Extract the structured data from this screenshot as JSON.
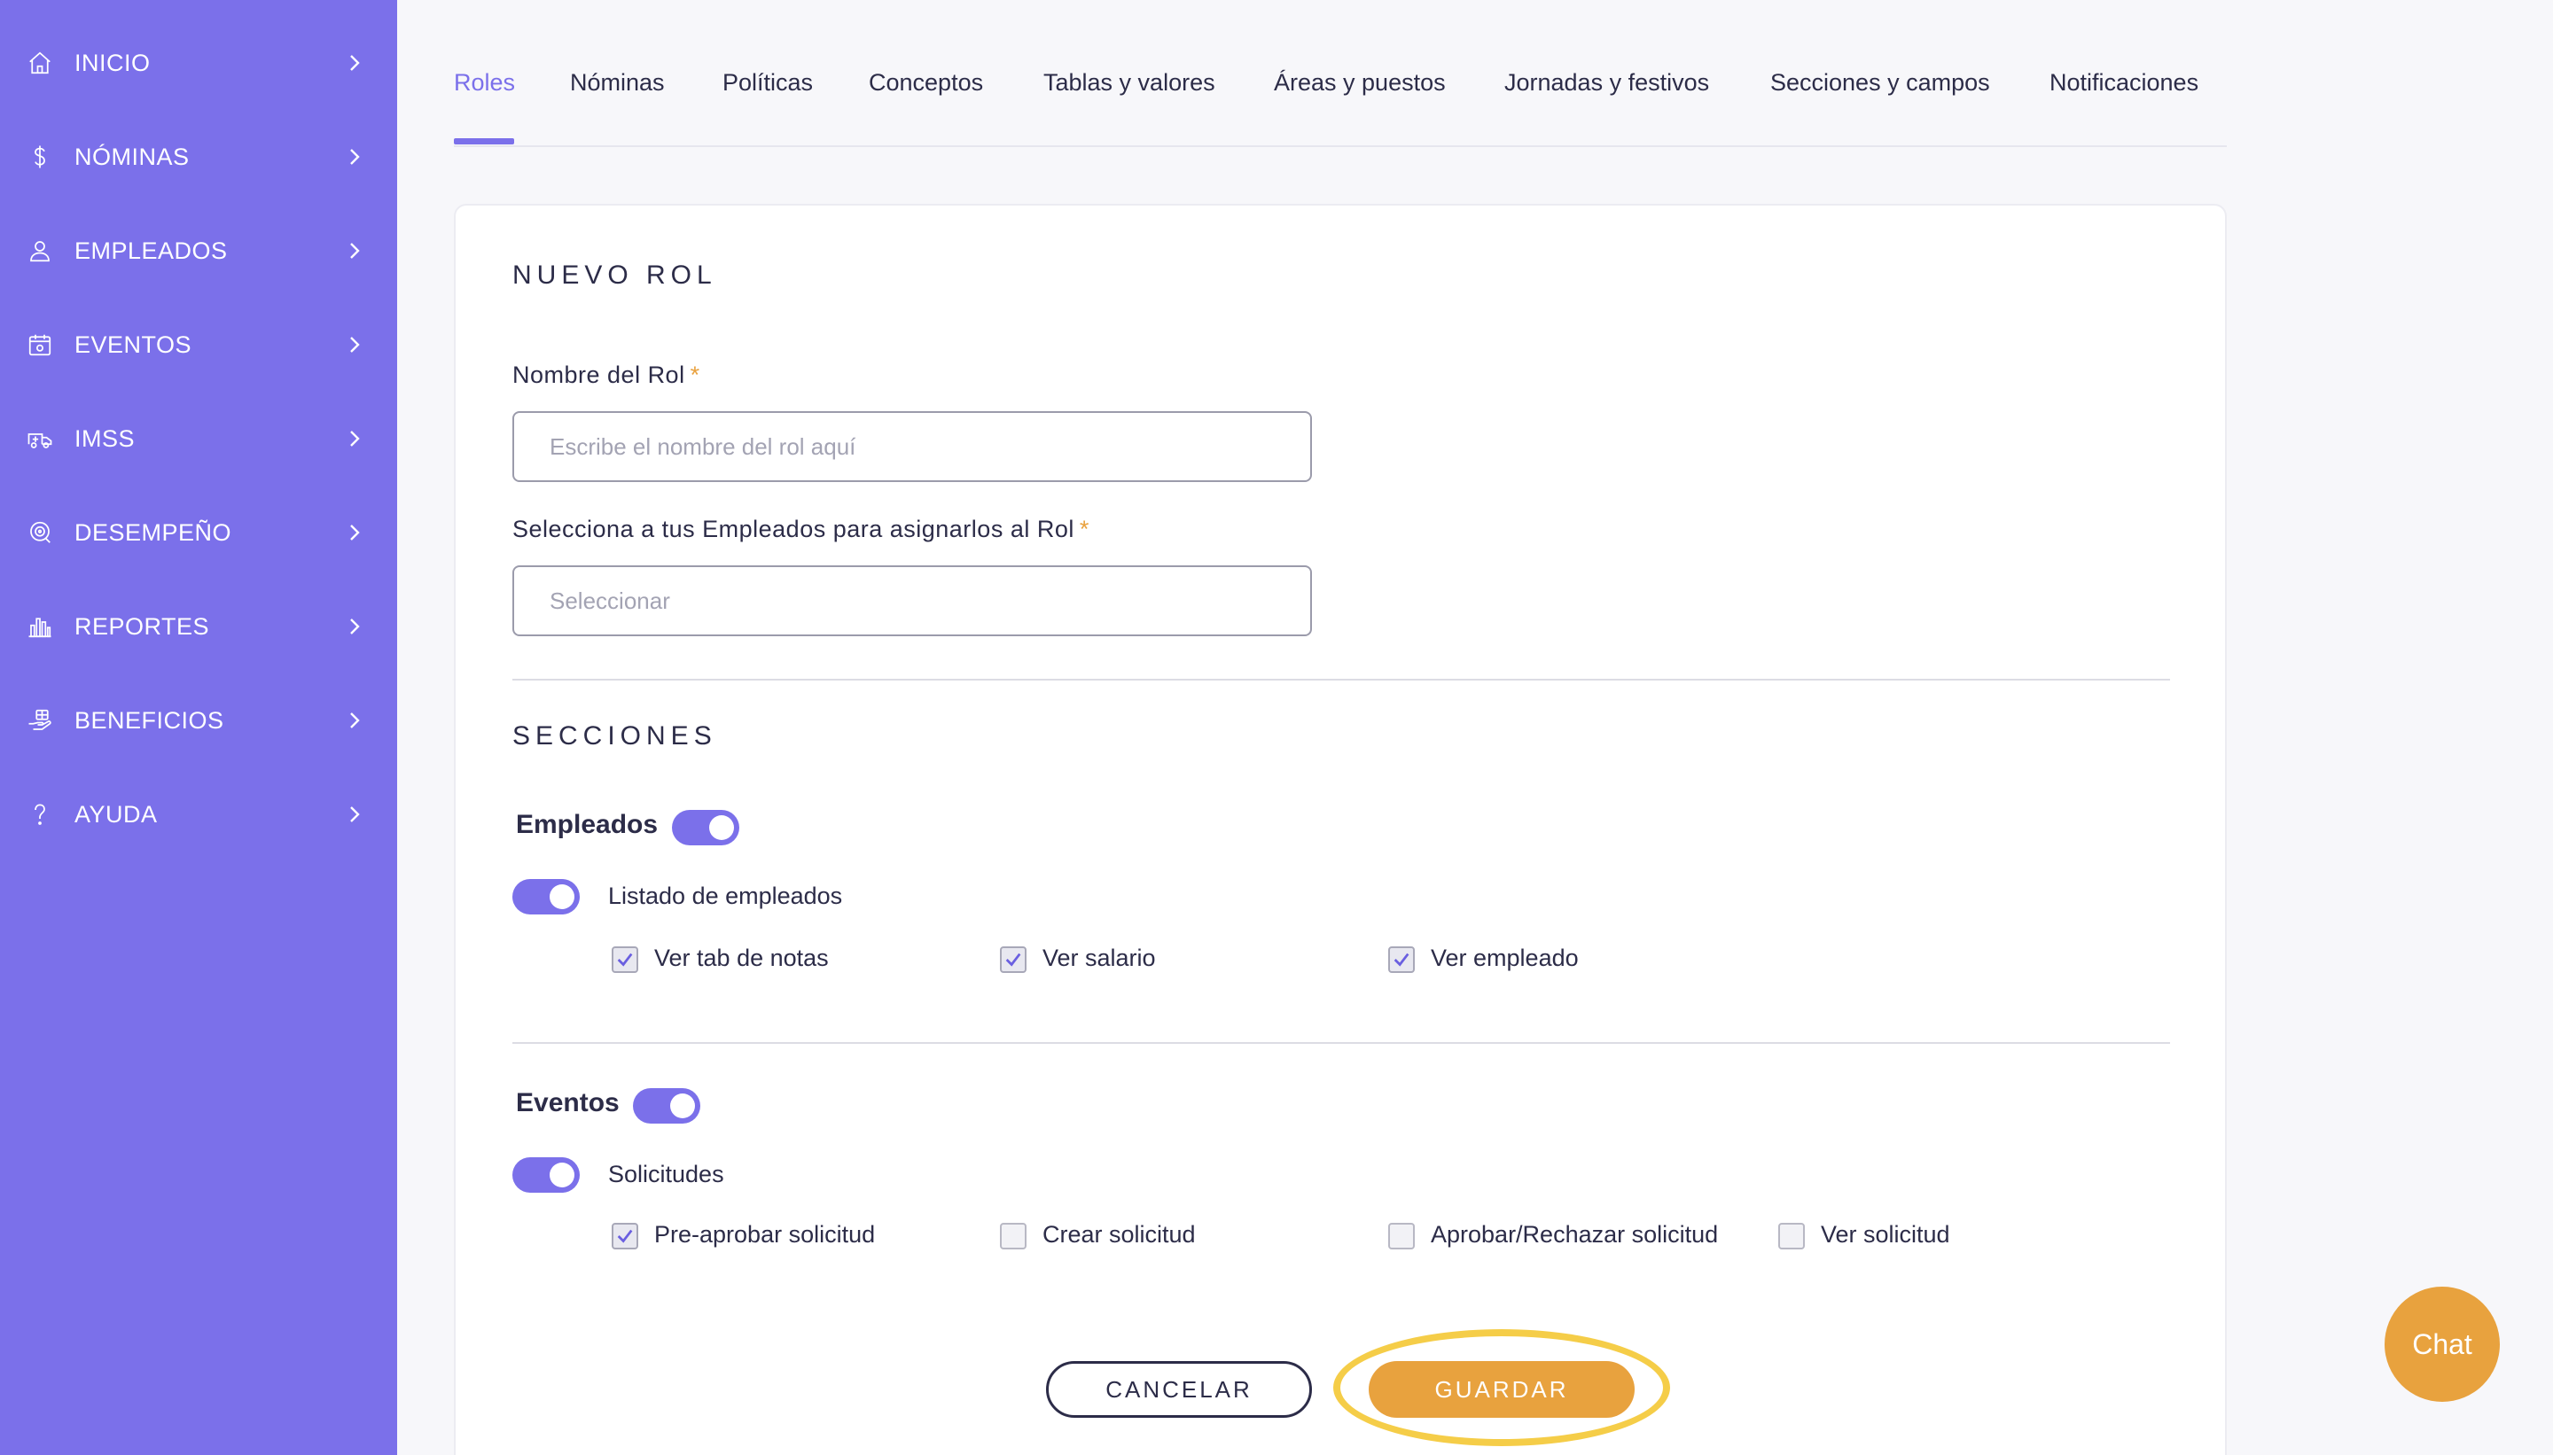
{
  "sidebar": {
    "items": [
      {
        "label": "INICIO",
        "icon": "home-icon"
      },
      {
        "label": "NÓMINAS",
        "icon": "dollar-icon"
      },
      {
        "label": "EMPLEADOS",
        "icon": "user-icon"
      },
      {
        "label": "EVENTOS",
        "icon": "calendar-icon"
      },
      {
        "label": "IMSS",
        "icon": "ambulance-icon"
      },
      {
        "label": "DESEMPEÑO",
        "icon": "target-icon"
      },
      {
        "label": "REPORTES",
        "icon": "bar-chart-icon"
      },
      {
        "label": "BENEFICIOS",
        "icon": "hand-gift-icon"
      },
      {
        "label": "AYUDA",
        "icon": "question-icon"
      }
    ]
  },
  "tabs": [
    {
      "label": "Roles",
      "active": true
    },
    {
      "label": "Nóminas"
    },
    {
      "label": "Políticas"
    },
    {
      "label": "Conceptos"
    },
    {
      "label": "Tablas y valores"
    },
    {
      "label": "Áreas y puestos"
    },
    {
      "label": "Jornadas y festivos"
    },
    {
      "label": "Secciones y campos"
    },
    {
      "label": "Notificaciones"
    }
  ],
  "form": {
    "title": "NUEVO ROL",
    "role_name": {
      "label": "Nombre del Rol",
      "required_mark": "*",
      "placeholder": "Escribe el nombre del rol aquí",
      "value": ""
    },
    "employees": {
      "label": "Selecciona a tus Empleados para asignarlos al Rol",
      "required_mark": "*",
      "placeholder": "Seleccionar"
    },
    "sections_title": "SECCIONES",
    "groups": [
      {
        "title": "Empleados",
        "enabled": true,
        "sub": {
          "label": "Listado de empleados",
          "enabled": true,
          "permissions": [
            {
              "label": "Ver tab de notas",
              "checked": true
            },
            {
              "label": "Ver salario",
              "checked": true
            },
            {
              "label": "Ver empleado",
              "checked": true
            }
          ]
        }
      },
      {
        "title": "Eventos",
        "enabled": true,
        "sub": {
          "label": "Solicitudes",
          "enabled": true,
          "permissions": [
            {
              "label": "Pre-aprobar solicitud",
              "checked": true
            },
            {
              "label": "Crear solicitud",
              "checked": false
            },
            {
              "label": "Aprobar/Rechazar solicitud",
              "checked": false
            },
            {
              "label": "Ver solicitud",
              "checked": false
            }
          ]
        }
      }
    ],
    "cancel_label": "CANCELAR",
    "save_label": "GUARDAR"
  },
  "chat_label": "Chat",
  "colors": {
    "sidebar": "#7b70ea",
    "accent": "#7b70ea",
    "primary_button": "#e8a23e",
    "highlight": "#f5cd48"
  }
}
